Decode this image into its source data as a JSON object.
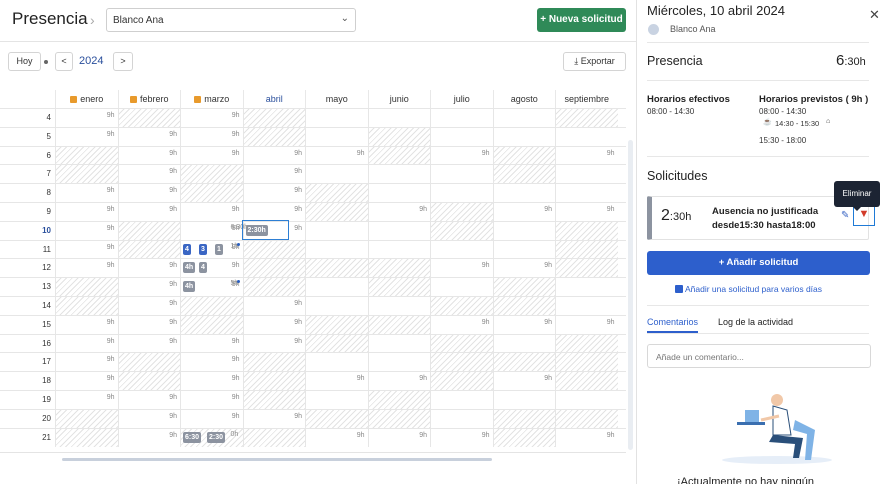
{
  "header": {
    "title": "Presencia",
    "employee": "Blanco Ana",
    "new_request": "+ Nueva solicitud"
  },
  "toolbar": {
    "today": "Hoy",
    "prev": "<",
    "year": "2024",
    "next": ">",
    "export": "Exportar"
  },
  "calendar": {
    "months": [
      {
        "name": "enero",
        "locked": true
      },
      {
        "name": "febrero",
        "locked": true
      },
      {
        "name": "marzo",
        "locked": true
      },
      {
        "name": "abril",
        "locked": false,
        "current": true
      },
      {
        "name": "mayo",
        "locked": false
      },
      {
        "name": "junio",
        "locked": false
      },
      {
        "name": "julio",
        "locked": false
      },
      {
        "name": "agosto",
        "locked": false
      },
      {
        "name": "septiembre",
        "locked": false
      }
    ],
    "rows": [
      4,
      5,
      6,
      7,
      8,
      9,
      10,
      11,
      12,
      13,
      14,
      15,
      16,
      17,
      18,
      19,
      20,
      21
    ],
    "hours_label": "9h",
    "chips": [
      {
        "row": 10,
        "month": 3,
        "text": "2:30h",
        "style": "g"
      },
      {
        "row": 11,
        "month": 2,
        "text": "4",
        "style": "b"
      },
      {
        "row": 11,
        "month": 2,
        "text": "3",
        "style": "b"
      },
      {
        "row": 11,
        "month": 2,
        "text": "1",
        "style": "g"
      },
      {
        "row": 12,
        "month": 2,
        "text": "4h",
        "style": "g"
      },
      {
        "row": 12,
        "month": 2,
        "text": "4",
        "style": "g"
      },
      {
        "row": 13,
        "month": 2,
        "text": "4h",
        "style": "g"
      },
      {
        "row": 21,
        "month": 2,
        "text": "6:30",
        "style": "g"
      },
      {
        "row": 21,
        "month": 2,
        "text": "2:30",
        "style": "g"
      }
    ],
    "extra_labels": [
      {
        "row": 10,
        "month": 3,
        "text": "6:30h"
      },
      {
        "row": 11,
        "month": 3,
        "text": "1h"
      },
      {
        "row": 13,
        "month": 3,
        "text": "5h"
      },
      {
        "row": 21,
        "month": 3,
        "text": "0h"
      }
    ]
  },
  "panel": {
    "date": "Miércoles, 10 abril 2024",
    "user": "Blanco Ana",
    "presence_label": "Presencia",
    "presence_total": "6",
    "presence_total_unit": ":30h",
    "effective_label": "Horarios efectivos",
    "effective_value": "08:00 - 14:30",
    "planned_label": "Horarios previstos ( 9h )",
    "planned_1": "08:00 - 14:30",
    "planned_2": "14:30 - 15:30",
    "planned_3": "15:30 - 18:00",
    "requests_label": "Solicitudes",
    "request_duration": "2",
    "request_duration_unit": ":30h",
    "request_type": "Ausencia no justificada",
    "request_range": "desde15:30 hasta18:00",
    "delete_tooltip": "Eliminar",
    "add_request": "+ Añadir solicitud",
    "add_multi": "Añadir una solicitud para varios días",
    "tab_comments": "Comentarios",
    "tab_log": "Log de la actividad",
    "comment_placeholder": "Añade un comentario...",
    "empty_text": "¡Actualmente no hay ningún"
  }
}
